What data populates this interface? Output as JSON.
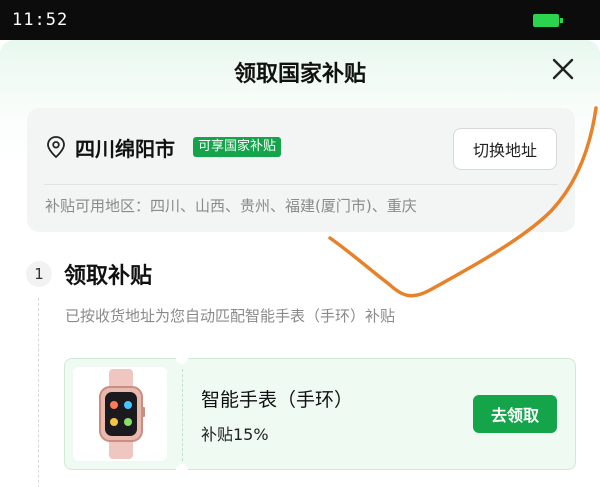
{
  "status_bar": {
    "time": "11:52"
  },
  "sheet": {
    "title": "领取国家补贴"
  },
  "address": {
    "city": "四川绵阳市",
    "tag": "可享国家补贴",
    "switch_label": "切换地址",
    "regions": "补贴可用地区：四川、山西、贵州、福建(厦门市)、重庆"
  },
  "step": {
    "number": "1",
    "title": "领取补贴",
    "description": "已按收货地址为您自动匹配智能手表（手环）补贴"
  },
  "product": {
    "name": "智能手表（手环）",
    "rate": "补贴15%",
    "claim_label": "去领取"
  },
  "colors": {
    "accent": "#14a44a",
    "annotation": "#e8822a"
  },
  "icons": {
    "close": "close-icon",
    "location": "location-pin-icon",
    "product": "smartwatch-image"
  }
}
